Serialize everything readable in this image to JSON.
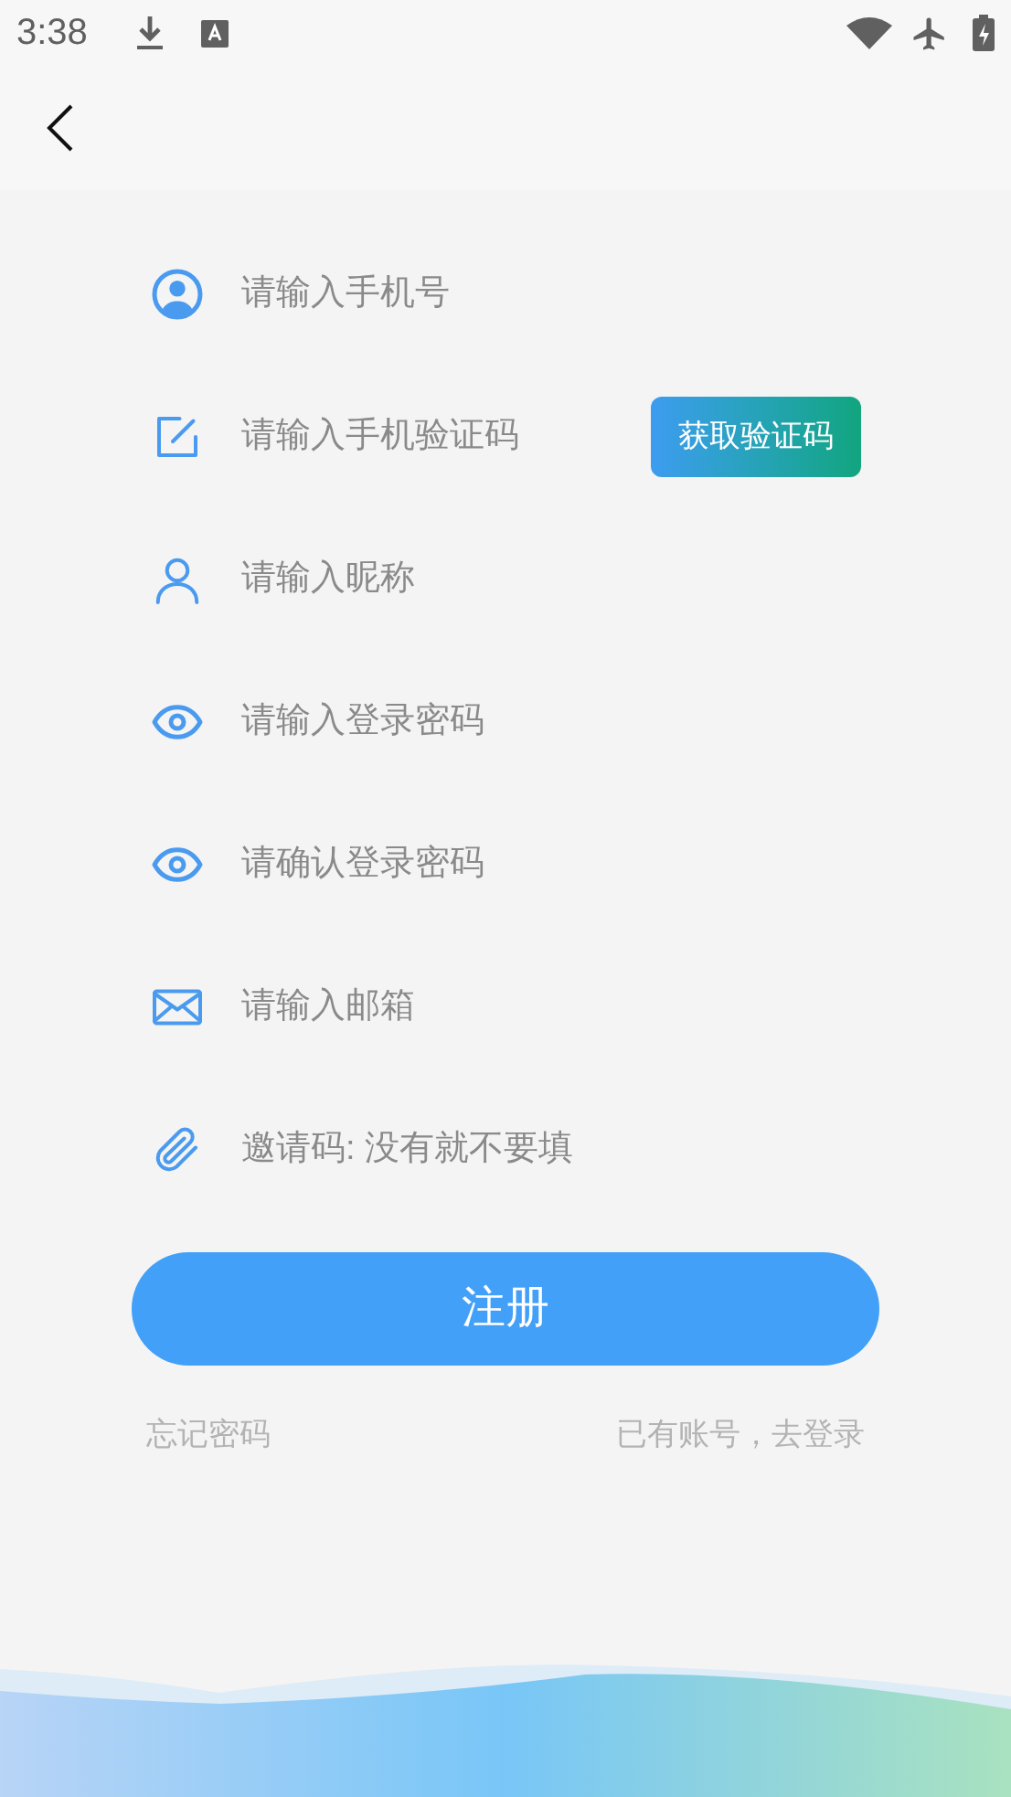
{
  "status_bar": {
    "time": "3:38"
  },
  "fields": [
    {
      "kind": "account",
      "placeholder": "请输入手机号"
    },
    {
      "kind": "edit",
      "placeholder": "请输入手机验证码",
      "button": "获取验证码"
    },
    {
      "kind": "person",
      "placeholder": "请输入昵称"
    },
    {
      "kind": "eye",
      "placeholder": "请输入登录密码"
    },
    {
      "kind": "eye",
      "placeholder": "请确认登录密码"
    },
    {
      "kind": "mail",
      "placeholder": "请输入邮箱"
    },
    {
      "kind": "clip",
      "placeholder": "邀请码: 没有就不要填"
    }
  ],
  "register_button": "注册",
  "links": {
    "forgot": "忘记密码",
    "login": "已有账号，去登录"
  }
}
